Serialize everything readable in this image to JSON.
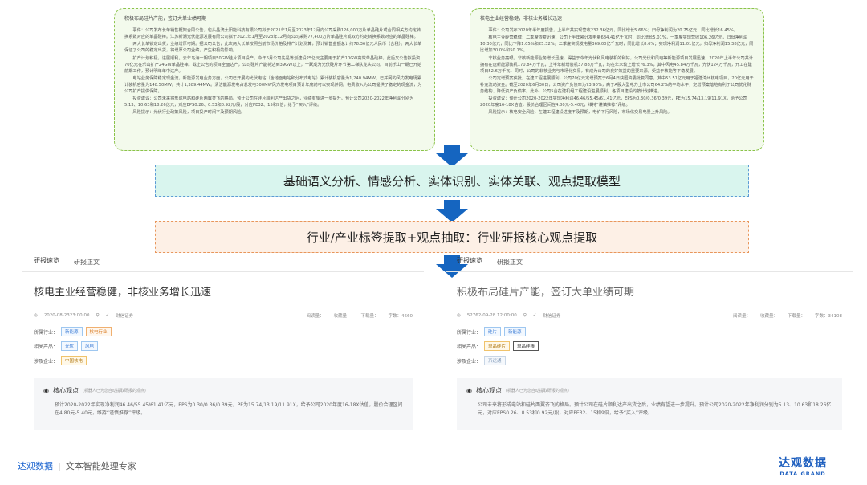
{
  "doc_left": {
    "title": "积极布局硅片产能，签订大单业绩可期",
    "paragraphs": [
      "事件：公司发布长单销售框架合同公告，包头晶澳太阳能科技有限公司拟于2021年1月至2023年12月向公司采购126,000万片单晶硅片或合同相关方约定转换系数对应的单晶硅棒。江苏新潮光伏能源发展有限公司拟于2021年1月至2023年12月向公司采购77,400万片单晶硅片或双方约定转换系数对应的单晶硅棒。",
      "两大长单锁定出货，业绩增厚可期。据公司公告，此次两大长单按照当前市场价格及排产计划测算，预计销售金额总计约78.36亿元人民币（含税）。两大长单保证了公司的稳定出货，将增厚公司业绩，产生积极的影响。",
      "扩产计划积极，进展顺利。去年乌海一期项目50GW硅片项目投产，今年6月公司先是筹划建设25亿元主要用于扩产10GW高效单晶硅棒，此后又公告拟投资70亿元在乐山扩产24GW单晶硅棒。截止公告的项目全面达产，公司硅片产能将达到39GW以上，一跃成为光伏硅片环节第二梯队龙头公司。目前乐山一期已开始前期工作，预计明年年中达产。",
      "电站业务保障稳定现金流，新能源发电业务方面，公司已开展的光伏电站（含地面电站和分布式电站）累计装机容量为1,240.94MW，已并网的风力发电场累计装机容量为148.50MW。共计1,389.44MW。清洁能源发电占总发电300MW风力发电项目预计年底前可以实现并网。电费收入为公司提供了稳定的现金流，为公司扩产提供保障。",
      "投资建议：公司未来将形成电站和硅片两翼齐飞的格局。预计公司在硅片顺利达产出货之后，业绩有望进一步提升。预计公司2020-2022年净利润分别为5.13、10.63和18.26亿元，对应EPS0.26、0.53和0.92元/股，对应PE32、15和9倍，给予“买入”评级。",
      "风险提示：光伏行业政策风险，项目投产时间不及预期风险。"
    ]
  },
  "doc_right": {
    "title": "核电主业经营稳健，非核业务增长迅速",
    "paragraphs": [
      "事件：公司发布2020年半年度报告，上半年共实现营收232.36亿元，同比增长5.66%；归母净利润为20.75亿元，同比增长16.45%。",
      "核电主业经营稳健：二季度恢复迅速，公司上半年累计发电量684.41亿千瓦时，同比增长5.01%，一季度实现营收106.26亿元，归母净利润10.30亿元，同比下降1.05%和25.32%。二季度实现发电量369.00亿千瓦时，同比增长8.6%；实现净利润11.01亿元，归母净利润15.38亿元，同比增加30.0%和50.1%。",
      "非核业务亮眼，非核新能源业务增长迅速，得益于今年光伏和风电装机的利好，公司光伏和风电等新能源项目发展迅速，2020年上半年公司共计拥有在运新能源装机170.84万千瓦，上半年新增装机37.88万千瓦，均在年末较上增长76.3%，其中风电45.84万千瓦，光伏124万千瓦，开工在建项目52.6万千瓦，同时，公司的非核业务与市场化交易，有成为公司的良好效益的重要来源，受益于核能等平稳发展。",
      "公司定增预案获批，在建工程进展顺利，公司70亿元定增预案于6月4日获国资委批复同意，其中53.51亿元用于福建漳州核电项目，20亿元用于补充流动资金。截至2020年6月30日，公司资产负债率为73.90%，高于A股大型电力上市公司64.2%的平均水平，定增预案落地有利于公司优化财务结构、降低资产负债率。此外，公司5台在建机组工程建设进展顺利，各项目建设均按计划推进。",
      "投资建议：预计公司2020-2022年实现净利润46.46/55.45/61.41亿元，EPS为0.30/0.36/0.39元，PE为15.74/13.19/11.91X，给予公司2020年度16-18X估值，股价合理区间在4.80元-5.40元，维持“谨慎推荐”评级。",
      "风险提示：核电安全风险，在建工程建设进度不及预期，电价下行风险，市场化交易电量上升风险。"
    ]
  },
  "band_1": {
    "label": "基础语义分析、情感分析、实体识别、实体关联、观点提取模型"
  },
  "band_2": {
    "label": "行业/产业标签提取+观点抽取：行业研报核心观点提取"
  },
  "card_left": {
    "tabs": [
      "研报速览",
      "研报正文"
    ],
    "title": "核电主业经营稳健，非核业务增长迅速",
    "date": "2020-08-2323:00:00",
    "source": "财信证券",
    "stats": [
      "阅读量：--",
      "收藏量：--",
      "下载量：--",
      "字数：4660"
    ],
    "industry_label": "所属行业：",
    "industry_tags": [
      "新能源",
      "核电行业"
    ],
    "product_label": "相关产品：",
    "product_tags": [
      "光伏",
      "风电"
    ],
    "company_label": "涉及企业：",
    "company_tags": [
      "中国核电"
    ],
    "core_title": "核心观点",
    "core_note": "(机器人已为您自动提取研报的观点)",
    "core_text": "预计2020-2022年实现净利润46.46/55.45/61.41亿元，EPS为0.30/0.36/0.39元，PE为15.74/13.19/11.91X，给予公司2020年度16-18X估值，股价合理区间在4.80元-5.40元，维持“谨慎推荐”评级。"
  },
  "card_right": {
    "tabs": [
      "研报速览",
      "研报正文"
    ],
    "title": "积极布局硅片产能，签订大单业绩可期",
    "date": "52762-09-28 12:00:00",
    "source": "财信证券",
    "stats": [
      "阅读量：--",
      "收藏量：--",
      "下载量：--",
      "字数：34108"
    ],
    "industry_label": "所属行业：",
    "industry_tags": [
      "硅片",
      "新能源"
    ],
    "product_label": "相关产品：",
    "product_tags": [
      "单晶硅片",
      "单晶硅棒"
    ],
    "company_label": "涉及企业：",
    "company_tags": [
      "京运通"
    ],
    "core_title": "核心观点",
    "core_note": "(机器人已为您自动提取研报的观点)",
    "core_text": "公司未来将形成电站和硅片两翼齐飞的格局。预计公司在硅片顺利达产出货之后，业绩有望进一步提升。预计公司2020-2022年净利润分别为5.13、10.63和18.26亿元，对应EPS0.26、0.53和0.92元/股，对应PE32、15和9倍，给予“买入”评级。"
  },
  "footer": {
    "brand": "达观数据",
    "separator": "|",
    "subtitle": "文本智能处理专家",
    "logo_cn": "达观数据",
    "logo_en": "DATA GRAND"
  },
  "colors": {
    "accent_blue": "#1e66d0",
    "band_1_bg": "#d9f5ee",
    "band_2_bg": "#fdf0e6",
    "doc_bg": "#f3faec"
  }
}
